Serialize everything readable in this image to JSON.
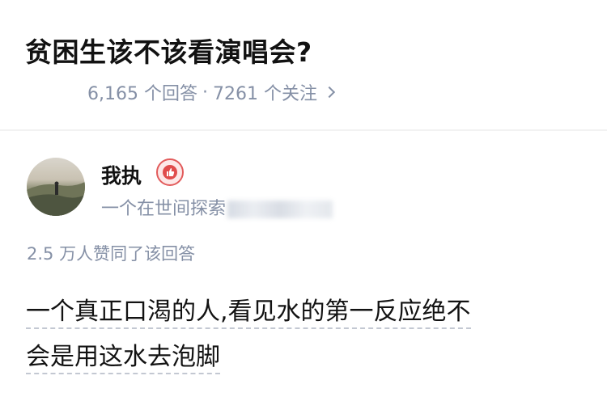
{
  "question": {
    "title": "贫困生该不该看演唱会?",
    "answers_count": "6,165 个回答",
    "separator": "·",
    "followers_count": "7261 个关注"
  },
  "author": {
    "name": "我执",
    "bio": "一个在世间探索",
    "badge_icon": "thumbs-up-badge-icon",
    "avatar_icon": "person-on-hill-avatar"
  },
  "answer": {
    "votes": "2.5 万人赞同了该回答",
    "text_line1": "一个真正口渴的人,看见水的第一反应绝不",
    "text_line2": "会是用这水去泡脚"
  },
  "colors": {
    "primary_text": "#121212",
    "secondary_text": "#8590a6",
    "badge_red": "#e04c4c"
  }
}
